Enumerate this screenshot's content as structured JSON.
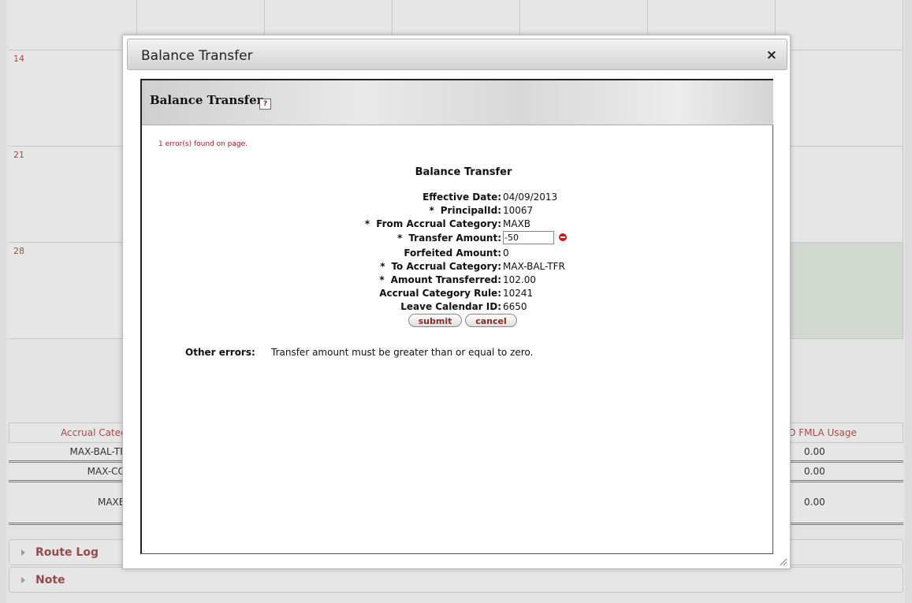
{
  "background": {
    "calendar_days": [
      "14",
      "21",
      "28"
    ],
    "accrual_table": {
      "headers": [
        "Accrual Categ",
        "O FMLA Usage"
      ],
      "rows": [
        {
          "category": "MAX-BAL-TF",
          "fmla": "0.00"
        },
        {
          "category": "MAX-CO",
          "fmla": "0.00"
        },
        {
          "category": "MAXB",
          "fmla": "0.00"
        }
      ]
    },
    "panels": [
      "Route Log",
      "Note"
    ]
  },
  "modal": {
    "title": "Balance Transfer",
    "close_symbol": "×",
    "section_title": "Balance Transfer",
    "help_symbol": "?",
    "error_count": "1 error(s) found on page.",
    "form_title": "Balance Transfer",
    "fields": [
      {
        "label": "Effective Date:",
        "required": false,
        "value": "04/09/2013"
      },
      {
        "label": "PrincipalId:",
        "required": true,
        "value": "10067"
      },
      {
        "label": "From Accrual Category:",
        "required": true,
        "value": "MAXB"
      },
      {
        "label": "Transfer Amount:",
        "required": true,
        "value": "-50"
      },
      {
        "label": "Forfeited Amount:",
        "required": false,
        "value": "0"
      },
      {
        "label": "To Accrual Category:",
        "required": true,
        "value": "MAX-BAL-TFR"
      },
      {
        "label": "Amount Transferred:",
        "required": true,
        "value": "102.00"
      },
      {
        "label": "Accrual Category Rule:",
        "required": false,
        "value": "10241"
      },
      {
        "label": "Leave Calendar ID:",
        "required": false,
        "value": "6650"
      }
    ],
    "required_marker": "*",
    "submit_label": "submit",
    "cancel_label": "cancel",
    "other_errors_label": "Other errors:",
    "other_errors_message": "Transfer amount must be greater than or equal to zero."
  },
  "colors": {
    "error_red": "#cc1a1a",
    "link_maroon": "#9a4747",
    "button_text": "#8a2a1f"
  }
}
